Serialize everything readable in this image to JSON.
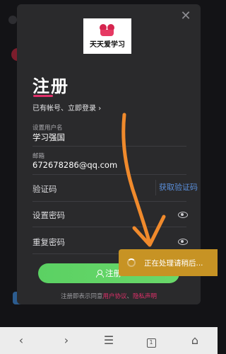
{
  "dialog": {
    "close_glyph": "✕",
    "logo_text": "天天爱学习",
    "title": "注册",
    "login_link": "已有帐号、立即登录",
    "login_chevron": "›",
    "username": {
      "label": "设置用户名",
      "value": "学习强国"
    },
    "email": {
      "label": "邮箱",
      "value": "672678286@qq.com"
    },
    "verify_code": {
      "label": "验证码",
      "button": "获取验证码"
    },
    "password": {
      "label": "设置密码"
    },
    "confirm_password": {
      "label": "重复密码"
    },
    "register_button": "注册",
    "terms": {
      "prefix": "注册即表示同意",
      "agreement": "用户协议",
      "and": "、",
      "privacy": "隐私声明"
    }
  },
  "toast": {
    "text": "正在处理请稍后..."
  },
  "navbar": {
    "back": "‹",
    "forward": "›",
    "menu": "☰",
    "tabs_count": "1",
    "home": "⌂"
  },
  "colors": {
    "accent": "#e0306a",
    "register_green": "#5bd163",
    "toast": "#c79324",
    "link_blue": "#5a8fdb",
    "arrow": "#f08a2c"
  }
}
